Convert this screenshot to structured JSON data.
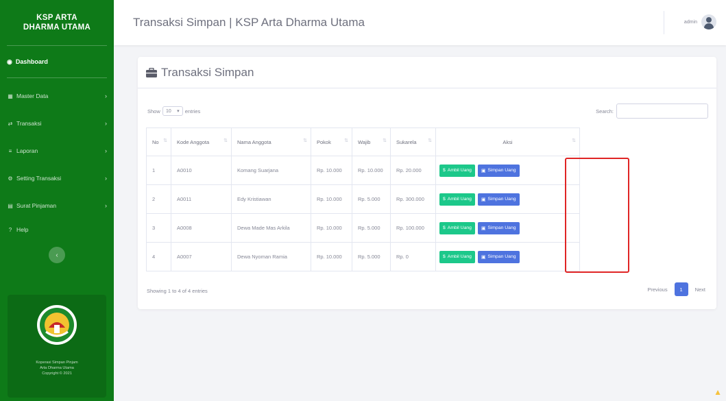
{
  "sidebar": {
    "brand": "KSP ARTA\nDHARMA UTAMA",
    "dashboard": "Dashboard",
    "items": [
      {
        "label": "Master Data",
        "icon": "table-icon"
      },
      {
        "label": "Transaksi",
        "icon": "exchange-icon"
      },
      {
        "label": "Laporan",
        "icon": "report-icon"
      },
      {
        "label": "Setting Transaksi",
        "icon": "settings-icon"
      },
      {
        "label": "Surat Pinjaman",
        "icon": "document-icon"
      },
      {
        "label": "Help",
        "icon": "help-icon"
      }
    ],
    "footer": [
      "Koperasi Simpan Pinjam",
      "Arta Dharma Utama",
      "Copyright © 2021"
    ]
  },
  "topbar": {
    "title": "Transaksi Simpan | KSP Arta Dharma Utama",
    "username": "admin"
  },
  "card": {
    "heading": "Transaksi Simpan",
    "show_label": "Show",
    "entries_value": "10",
    "entries_label": "entries",
    "search_label": "Search:"
  },
  "table": {
    "columns": [
      "No",
      "Kode Anggota",
      "Nama Anggota",
      "Pokok",
      "Wajib",
      "Sukarela",
      "Aksi"
    ],
    "rows": [
      {
        "no": "1",
        "kode": "A0010",
        "nama": "Komang Suarjana",
        "pokok": "Rp. 10.000",
        "wajib": "Rp. 10.000",
        "sukarela": "Rp. 20.000"
      },
      {
        "no": "2",
        "kode": "A0011",
        "nama": "Edy Kristiawan",
        "pokok": "Rp. 10.000",
        "wajib": "Rp. 5.000",
        "sukarela": "Rp. 300.000"
      },
      {
        "no": "3",
        "kode": "A0008",
        "nama": "Dewa Made Mas Arkila",
        "pokok": "Rp. 10.000",
        "wajib": "Rp. 5.000",
        "sukarela": "Rp. 100.000"
      },
      {
        "no": "4",
        "kode": "A0007",
        "nama": "Dewa Nyoman Ramia",
        "pokok": "Rp. 10.000",
        "wajib": "Rp. 5.000",
        "sukarela": "Rp. 0"
      }
    ],
    "ambil_label": "Ambil Uang",
    "simpan_label": "Simpan Uang"
  },
  "footer": {
    "info": "Showing 1 to 4 of 4 entries",
    "previous": "Previous",
    "page": "1",
    "next": "Next"
  },
  "colors": {
    "sidebar": "#0e7a18",
    "ambil": "#1cc88a",
    "simpan": "#4e73df",
    "highlight": "#e02424"
  }
}
